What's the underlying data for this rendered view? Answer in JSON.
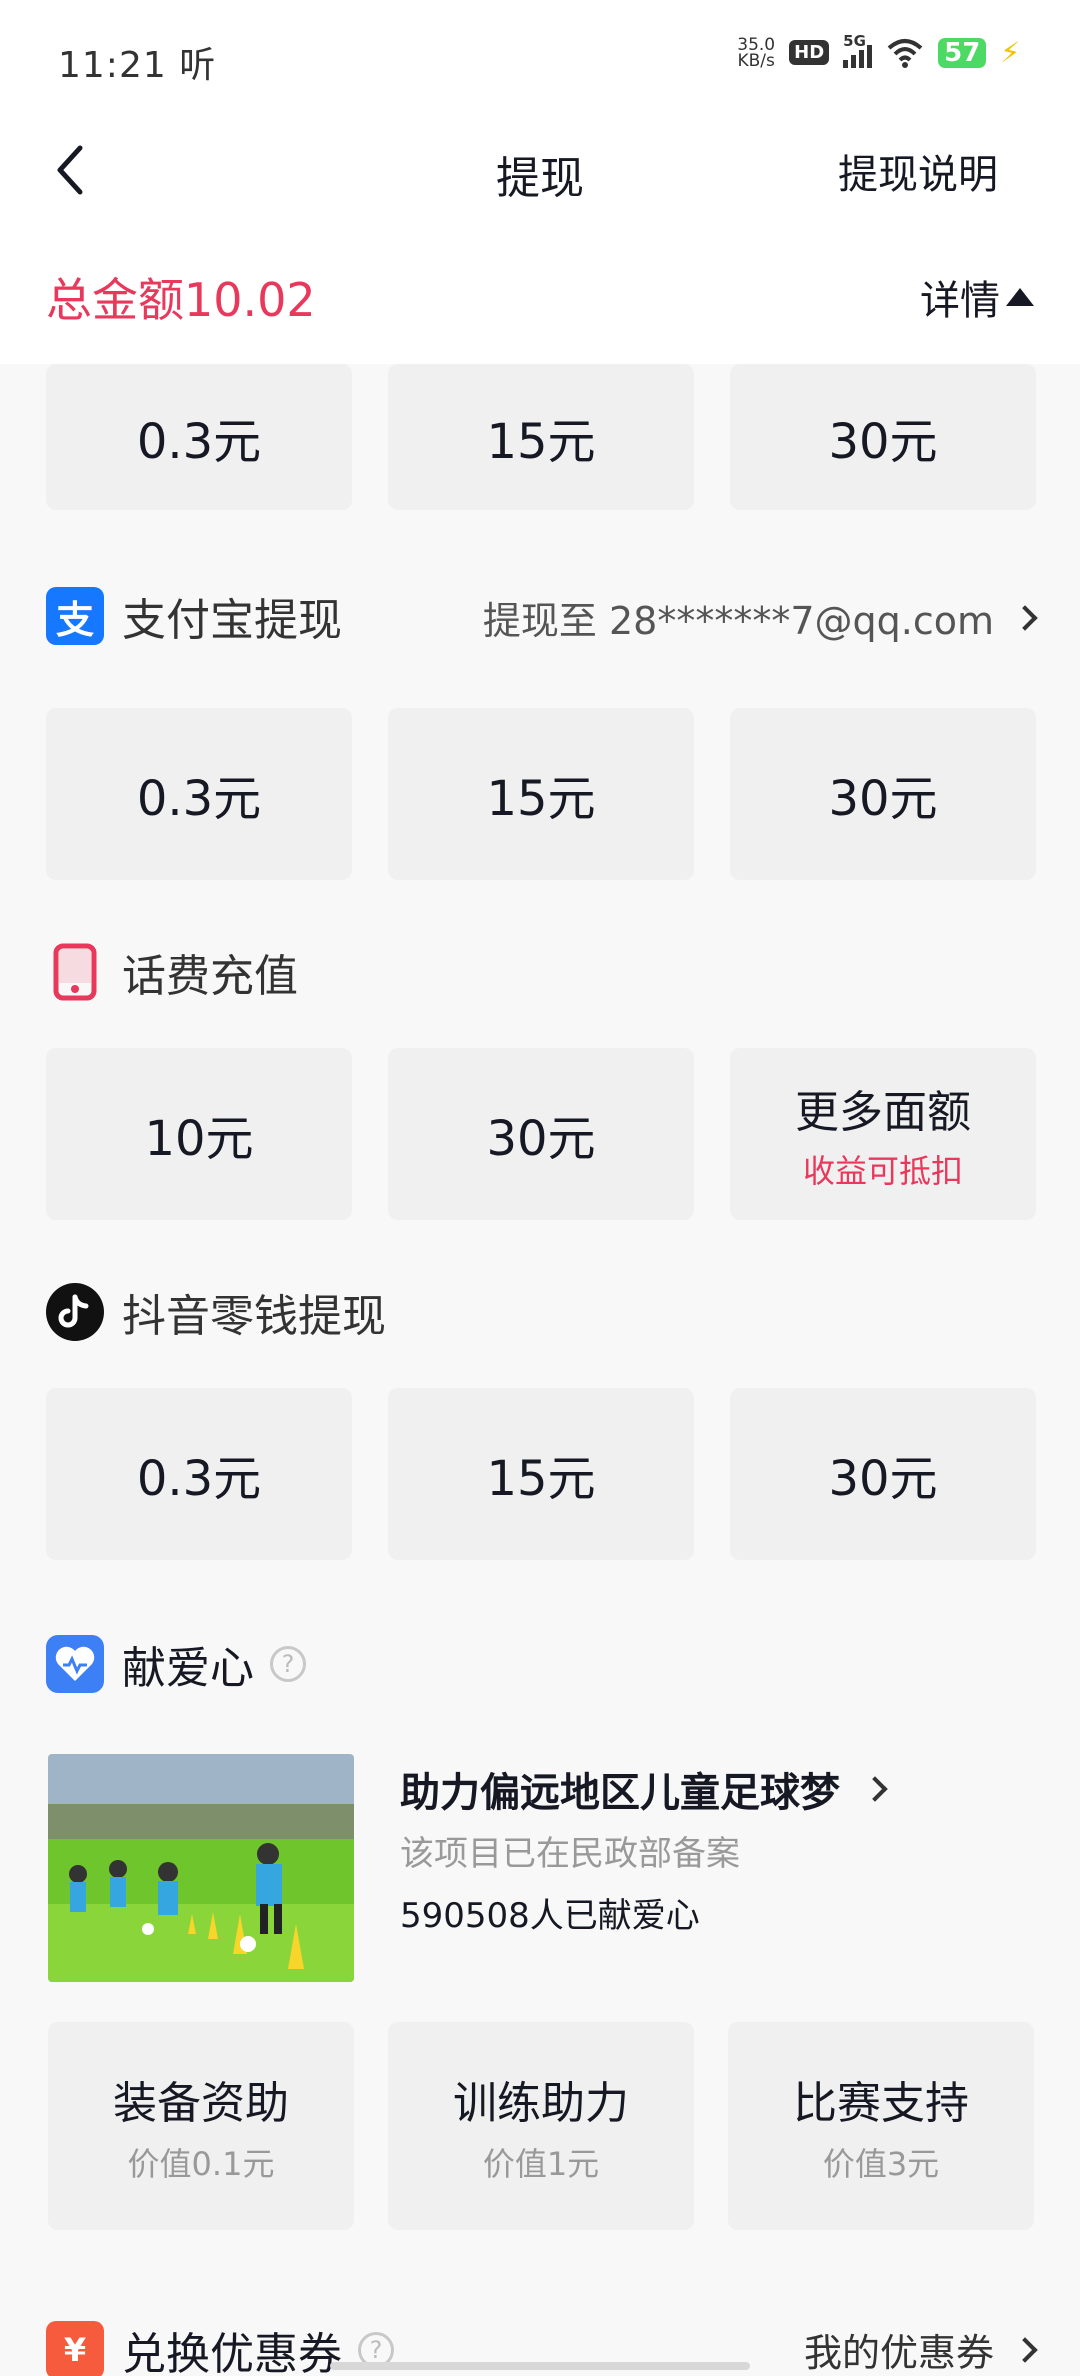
{
  "status": {
    "time": "11:21",
    "time_suffix": "听",
    "net_speed_value": "35.0",
    "net_speed_unit": "KB/s",
    "hd": "HD",
    "network": "5G",
    "battery": "57"
  },
  "nav": {
    "title": "提现",
    "right_link": "提现说明"
  },
  "summary": {
    "total_label": "总金额10.02",
    "detail_label": "详情"
  },
  "top_partial_grid": [
    "0.3元",
    "15元",
    "30元"
  ],
  "alipay": {
    "title": "支付宝提现",
    "icon_char": "支",
    "target": "提现至 28*******7@qq.com",
    "options": [
      "0.3元",
      "15元",
      "30元"
    ]
  },
  "phone": {
    "title": "话费充值",
    "options": [
      "10元",
      "30元"
    ],
    "more_label": "更多面额",
    "more_sub": "收益可抵扣"
  },
  "douyin": {
    "title": "抖音零钱提现",
    "options": [
      "0.3元",
      "15元",
      "30元"
    ]
  },
  "charity": {
    "title": "献爱心",
    "help": "?",
    "project_title": "助力偏远地区儿童足球梦",
    "project_sub": "该项目已在民政部备案",
    "project_count": "590508人已献爱心",
    "options": [
      {
        "label": "装备资助",
        "sub": "价值0.1元"
      },
      {
        "label": "训练助力",
        "sub": "价值1元"
      },
      {
        "label": "比赛支持",
        "sub": "价值3元"
      }
    ]
  },
  "coupon": {
    "title": "兑换优惠券",
    "icon_char": "¥",
    "help": "?",
    "right_link": "我的优惠券"
  },
  "colors": {
    "accent_red": "#e8395c",
    "alipay_blue": "#1677ff",
    "charity_blue": "#3d7ff5",
    "coupon_orange": "#f55b3c"
  }
}
